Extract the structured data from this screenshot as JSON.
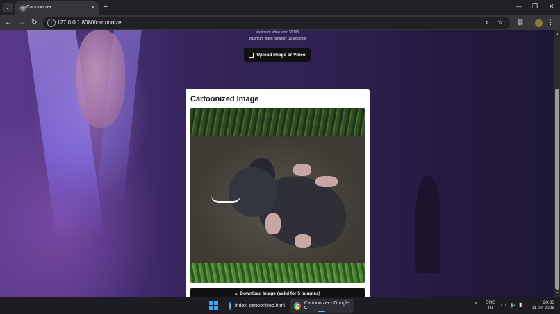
{
  "browser": {
    "tab_title": "Cartoonizer",
    "new_tab": "+",
    "url": "127.0.0.1:8080/cartoonize",
    "window_controls": {
      "minimize": "—",
      "restore": "❐",
      "close": "✕"
    }
  },
  "page": {
    "upload_info_cut": "Maximum video size: 30 MB",
    "upload_info_duration": "Maximum video duration: 10 seconds",
    "upload_button": "Upload Image or Video",
    "card_title": "Cartoonized Image",
    "download_button": "Download Image (Valid for 5 minutes)"
  },
  "taskbar": {
    "items": [
      {
        "label": "index_cartoonized.html",
        "icon": "vscode-icon"
      },
      {
        "label": "Cartoonizer - Google Cl",
        "icon": "chrome-icon"
      }
    ],
    "language": "ENG",
    "region": "IN",
    "time": "20:33",
    "date": "01-07-2025"
  },
  "colors": {
    "tabbar": "#202124",
    "toolbar": "#35363a",
    "button_dark": "#111111",
    "taskbar": "#1c1c22",
    "page_bg": "#35245a"
  }
}
